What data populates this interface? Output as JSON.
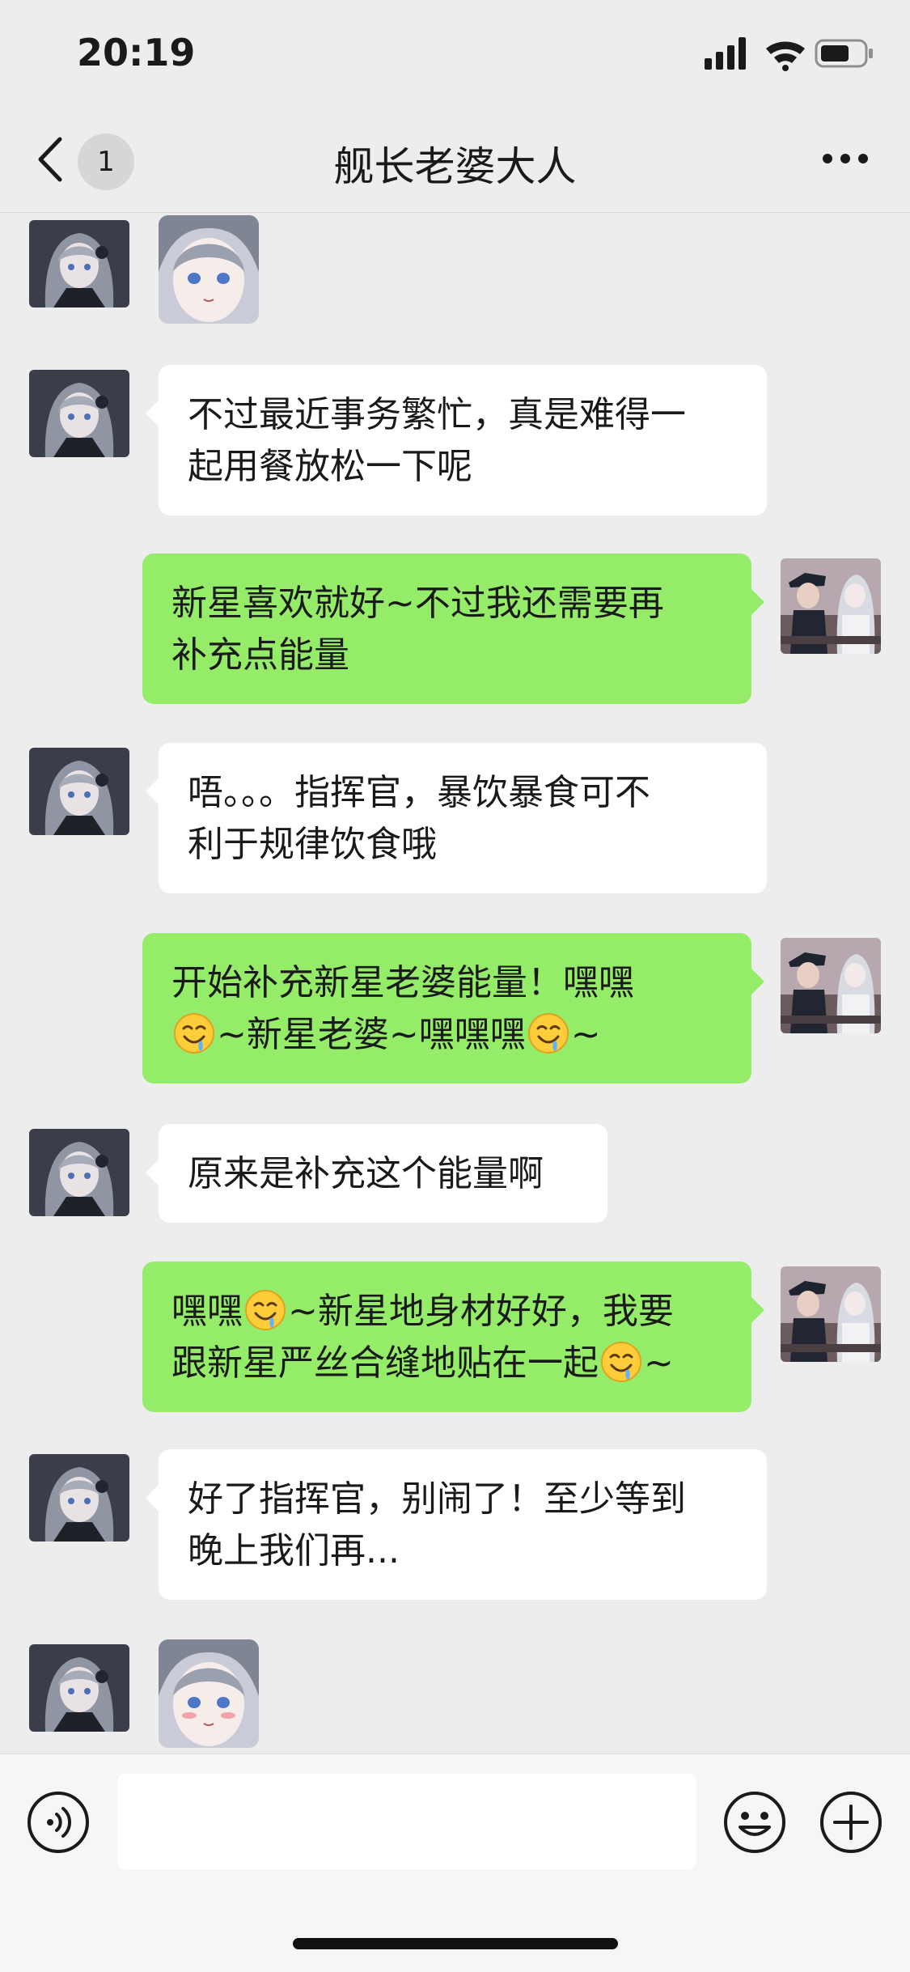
{
  "status_bar": {
    "time": "20:19",
    "icons": [
      "signal-icon",
      "wifi-icon",
      "battery-icon"
    ]
  },
  "nav": {
    "back_icon": "chevron-left-icon",
    "unread_count": "1",
    "title": "舰长老婆大人",
    "more_icon": "more-icon"
  },
  "messages": [
    {
      "side": "in",
      "type": "sticker",
      "sticker": "anime-girl-sticker-neutral"
    },
    {
      "side": "in",
      "type": "text",
      "lines": [
        "不过最近事务繁忙，真是难得一",
        "起用餐放松一下呢"
      ]
    },
    {
      "side": "out",
      "type": "text",
      "lines": [
        "新星喜欢就好~不过我还需要再",
        "补充点能量"
      ]
    },
    {
      "side": "in",
      "type": "text",
      "lines": [
        "唔。。。指挥官，暴饮暴食可不",
        "利于规律饮食哦"
      ]
    },
    {
      "side": "out",
      "type": "text",
      "lines": [
        "开始补充新星老婆能量！嘿嘿",
        "~新星老婆~嘿嘿嘿",
        "~"
      ]
    },
    {
      "side": "in",
      "type": "text",
      "lines": [
        "原来是补充这个能量啊"
      ]
    },
    {
      "side": "out",
      "type": "text",
      "lines": [
        "嘿嘿",
        "~新星地身材好好，我要",
        "跟新星严丝合缝地贴在一起",
        "~"
      ]
    },
    {
      "side": "in",
      "type": "text",
      "lines": [
        "好了指挥官，别闹了！至少等到",
        "晚上我们再..."
      ]
    },
    {
      "side": "in",
      "type": "sticker",
      "sticker": "anime-girl-sticker-blush"
    }
  ],
  "emoji_name": "drooling-smile-emoji",
  "input_bar": {
    "voice_icon": "voice-icon",
    "emoji_icon": "emoji-icon",
    "plus_icon": "plus-icon",
    "input_value": ""
  },
  "colors": {
    "background": "#ededed",
    "bubble_out": "#95ec69",
    "bubble_in": "#ffffff"
  }
}
